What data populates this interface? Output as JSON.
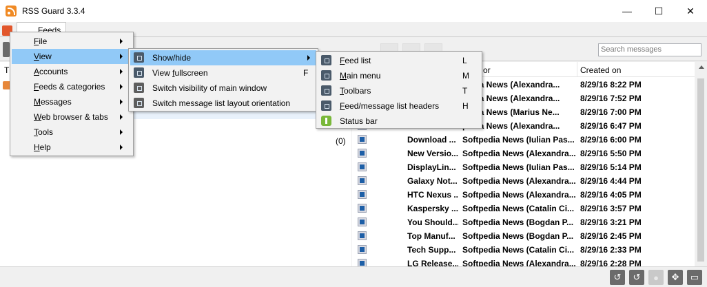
{
  "window": {
    "title": "RSS Guard 3.3.4",
    "minimize": "—",
    "maximize": "☐",
    "close": "✕"
  },
  "tabs": [
    {
      "label": "Feeds"
    }
  ],
  "search": {
    "placeholder": "Search messages"
  },
  "feeds_pane": {
    "header_first": "T",
    "unread_count": "(0)"
  },
  "message_list": {
    "headers": {
      "author": "or",
      "created_on": "Created on"
    },
    "rows": [
      {
        "title": "",
        "author": "pedia News (Alexandra...",
        "date": "8/29/16 8:22 PM"
      },
      {
        "title": "",
        "author": "pedia News (Alexandra...",
        "date": "8/29/16 7:52 PM"
      },
      {
        "title": "",
        "author": "pedia News (Marius Ne...",
        "date": "8/29/16 7:00 PM"
      },
      {
        "title": "",
        "author": "pedia News (Alexandra...",
        "date": "8/29/16 6:47 PM"
      },
      {
        "title": "Download ...",
        "author": "Softpedia News (Iulian Pas...",
        "date": "8/29/16 6:00 PM"
      },
      {
        "title": "New Versio...",
        "author": "Softpedia News (Alexandra...",
        "date": "8/29/16 5:50 PM"
      },
      {
        "title": "DisplayLin...",
        "author": "Softpedia News (Iulian Pas...",
        "date": "8/29/16 5:14 PM"
      },
      {
        "title": "Galaxy Not...",
        "author": "Softpedia News (Alexandra...",
        "date": "8/29/16 4:44 PM"
      },
      {
        "title": "HTC Nexus ...",
        "author": "Softpedia News (Alexandra...",
        "date": "8/29/16 4:05 PM"
      },
      {
        "title": "Kaspersky ...",
        "author": "Softpedia News (Catalin Ci...",
        "date": "8/29/16 3:57 PM"
      },
      {
        "title": "You Should...",
        "author": "Softpedia News (Bogdan P...",
        "date": "8/29/16 3:21 PM"
      },
      {
        "title": "Top Manuf...",
        "author": "Softpedia News (Bogdan P...",
        "date": "8/29/16 2:45 PM"
      },
      {
        "title": "Tech Supp...",
        "author": "Softpedia News (Catalin Ci...",
        "date": "8/29/16 2:33 PM"
      },
      {
        "title": "LG Release...",
        "author": "Softpedia News (Alexandra...",
        "date": "8/29/16 2:28 PM"
      }
    ]
  },
  "main_menu": {
    "items": [
      {
        "label": "File",
        "mnemonic": "F",
        "rest": "ile"
      },
      {
        "label": "View",
        "mnemonic": "V",
        "rest": "iew"
      },
      {
        "label": "Accounts",
        "mnemonic": "A",
        "rest": "ccounts"
      },
      {
        "label": "Feeds & categories",
        "mnemonic": "F",
        "rest": "eeds & categories"
      },
      {
        "label": "Messages",
        "mnemonic": "M",
        "rest": "essages"
      },
      {
        "label": "Web browser & tabs",
        "mnemonic": "W",
        "rest": "eb browser & tabs"
      },
      {
        "label": "Tools",
        "mnemonic": "T",
        "rest": "ools"
      },
      {
        "label": "Help",
        "mnemonic": "H",
        "rest": "elp"
      }
    ]
  },
  "view_menu": {
    "items": [
      {
        "label": "Show/hide",
        "shortcut": ""
      },
      {
        "label": "View fullscreen",
        "pre": "View ",
        "mnemonic": "f",
        "rest": "ullscreen",
        "shortcut": "F"
      },
      {
        "label": "Switch visibility of main window",
        "shortcut": ""
      },
      {
        "label": "Switch message list layout orientation",
        "shortcut": ""
      }
    ]
  },
  "showhide_menu": {
    "items": [
      {
        "label": "Feed list",
        "mnemonic": "F",
        "rest": "eed list",
        "shortcut": "L"
      },
      {
        "label": "Main menu",
        "mnemonic": "M",
        "rest": "ain menu",
        "shortcut": "M"
      },
      {
        "label": "Toolbars",
        "mnemonic": "T",
        "rest": "oolbars",
        "shortcut": "T"
      },
      {
        "label": "Feed/message list headers",
        "mnemonic": "F",
        "rest": "eed/message list headers",
        "shortcut": "H"
      },
      {
        "label": "Status bar",
        "mnemonic": "",
        "rest": "Status bar",
        "shortcut": ""
      }
    ]
  },
  "watermark": "SOFTPEDIA",
  "statusbar": {
    "buttons": [
      "↺",
      "↺",
      "●",
      "✥",
      "▭"
    ]
  }
}
